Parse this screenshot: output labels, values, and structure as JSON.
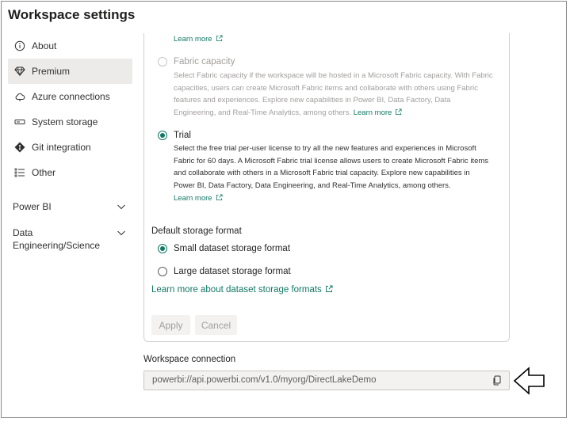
{
  "window": {
    "title": "Workspace settings"
  },
  "sidebar": {
    "items": [
      {
        "label": "About",
        "icon": "info-icon"
      },
      {
        "label": "Premium",
        "icon": "diamond-icon",
        "selected": true
      },
      {
        "label": "Azure connections",
        "icon": "cloud-icon"
      },
      {
        "label": "System storage",
        "icon": "storage-icon"
      },
      {
        "label": "Git integration",
        "icon": "git-icon"
      },
      {
        "label": "Other",
        "icon": "list-icon"
      }
    ],
    "sections": [
      {
        "label": "Power BI"
      },
      {
        "label": "Data Engineering/Science"
      }
    ]
  },
  "premium": {
    "top_learn_more": "Learn more",
    "fabric_capacity": {
      "label": "Fabric capacity",
      "selected": false,
      "disabled": true,
      "description": "Select Fabric capacity if the workspace will be hosted in a Microsoft Fabric capacity. With Fabric capacities, users can create Microsoft Fabric items and collaborate with others using Fabric features and experiences. Explore new capabilities in Power BI, Data Factory, Data Engineering, and Real-Time Analytics, among others.",
      "learn_more": "Learn more"
    },
    "trial": {
      "label": "Trial",
      "selected": true,
      "description": "Select the free trial per-user license to try all the new features and experiences in Microsoft Fabric for 60 days. A Microsoft Fabric trial license allows users to create Microsoft Fabric items and collaborate with others in a Microsoft Fabric trial capacity. Explore new capabilities in Power BI, Data Factory, Data Engineering, and Real-Time Analytics, among others.",
      "learn_more": "Learn more"
    },
    "storage_format": {
      "heading": "Default storage format",
      "options": [
        {
          "label": "Small dataset storage format",
          "selected": true
        },
        {
          "label": "Large dataset storage format",
          "selected": false
        }
      ],
      "learn_more": "Learn more about dataset storage formats"
    },
    "apply_label": "Apply",
    "cancel_label": "Cancel"
  },
  "connection": {
    "heading": "Workspace connection",
    "value": "powerbi://api.powerbi.com/v1.0/myorg/DirectLakeDemo"
  },
  "colors": {
    "accent": "#117865",
    "selected_bg": "#edebe9",
    "disabled_text": "#a19f9d"
  }
}
